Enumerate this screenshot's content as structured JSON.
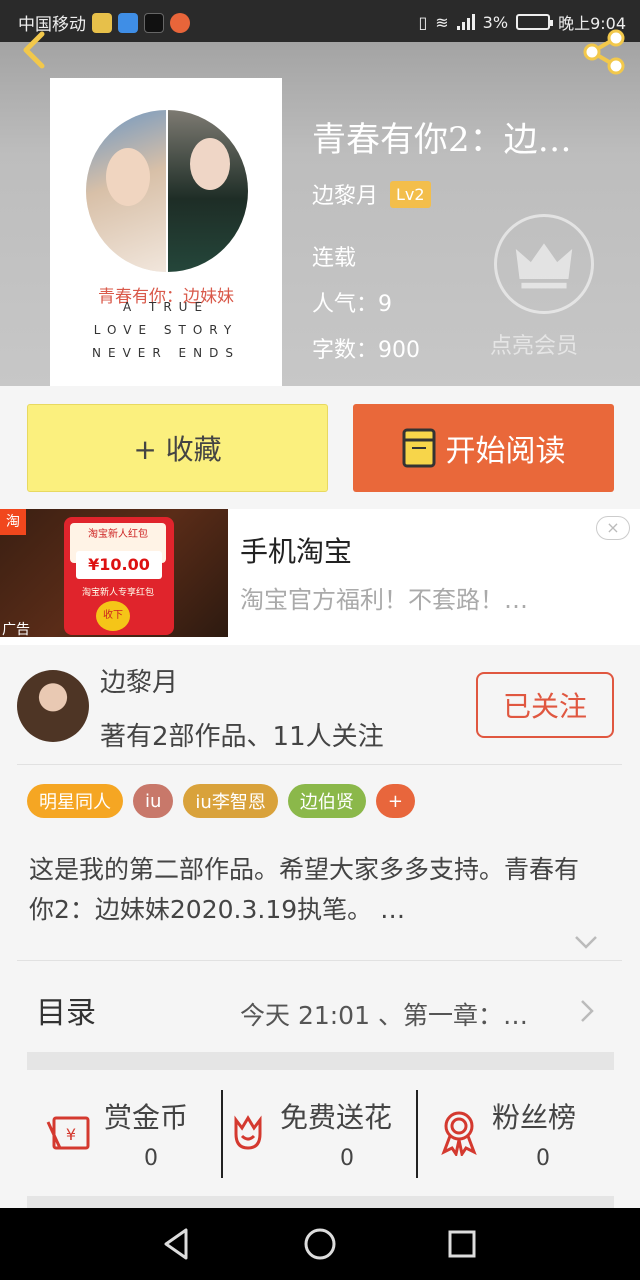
{
  "status_bar": {
    "carrier": "中国移动",
    "network": "3%",
    "time": "晚上9:04"
  },
  "book": {
    "title": "青春有你2：边…",
    "author": "边黎月",
    "level": "Lv2",
    "status": "连载",
    "popularity": "人气：9",
    "word_count": "字数：900",
    "cover": {
      "title": "青春有你：边妹妹",
      "line1": "A TRUE",
      "line2": "LOVE STORY",
      "line3": "NEVER ENDS"
    },
    "vip_label": "点亮会员"
  },
  "actions": {
    "collect": "+ 收藏",
    "read": "开始阅读"
  },
  "ad": {
    "title": "手机淘宝",
    "desc": "淘宝官方福利！不套路！…",
    "label": "广告",
    "badge": "淘",
    "envelope_top": "淘宝新人红包",
    "amount": "¥10.00",
    "envelope_sub": "淘宝新人专享红包",
    "coin": "收下",
    "close": "×"
  },
  "author_card": {
    "name": "边黎月",
    "meta": "著有2部作品、11人关注",
    "follow": "已关注"
  },
  "tags": [
    {
      "label": "明星同人",
      "color": "#f5a623"
    },
    {
      "label": "iu",
      "color": "#c8786a"
    },
    {
      "label": "iu李智恩",
      "color": "#d9a23b"
    },
    {
      "label": "边伯贤",
      "color": "#8bb84a"
    },
    {
      "label": "+",
      "color": "#e8663c"
    }
  ],
  "description": "这是我的第二部作品。希望大家多多支持。青春有你2：边妹妹2020.3.19执笔。 …",
  "toc": {
    "label": "目录",
    "latest": "今天 21:01 、第一章：…"
  },
  "stats": [
    {
      "label": "赏金币",
      "value": "0",
      "icon": "coin-envelope-icon"
    },
    {
      "label": "免费送花",
      "value": "0",
      "icon": "flower-icon"
    },
    {
      "label": "粉丝榜",
      "value": "0",
      "icon": "medal-icon"
    }
  ],
  "colors": {
    "accent_orange": "#e9683a",
    "collect_yellow": "#fbf07e",
    "follow_red": "#e05740",
    "level_badge": "#f3be4b"
  }
}
